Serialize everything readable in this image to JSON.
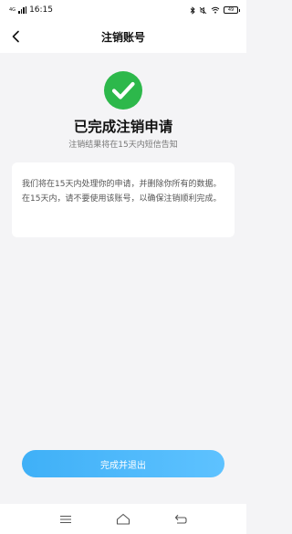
{
  "status_bar": {
    "carrier": "4G",
    "time": "16:15",
    "battery": "49"
  },
  "nav": {
    "title": "注销账号"
  },
  "result": {
    "title": "已完成注销申请",
    "subtitle": "注销结果将在15天内短信告知"
  },
  "info": {
    "text": "我们将在15天内处理你的申请，并删除你所有的数据。在15天内，请不要使用该账号，以确保注销顺利完成。"
  },
  "actions": {
    "done_label": "完成并退出"
  },
  "colors": {
    "accent": "#3fb0f7",
    "success": "#2db84b",
    "background": "#f4f4f6"
  },
  "icons": {
    "back": "chevron-left-icon",
    "success": "check-circle-icon",
    "menu": "menu-icon",
    "home": "home-icon",
    "return": "return-icon"
  }
}
